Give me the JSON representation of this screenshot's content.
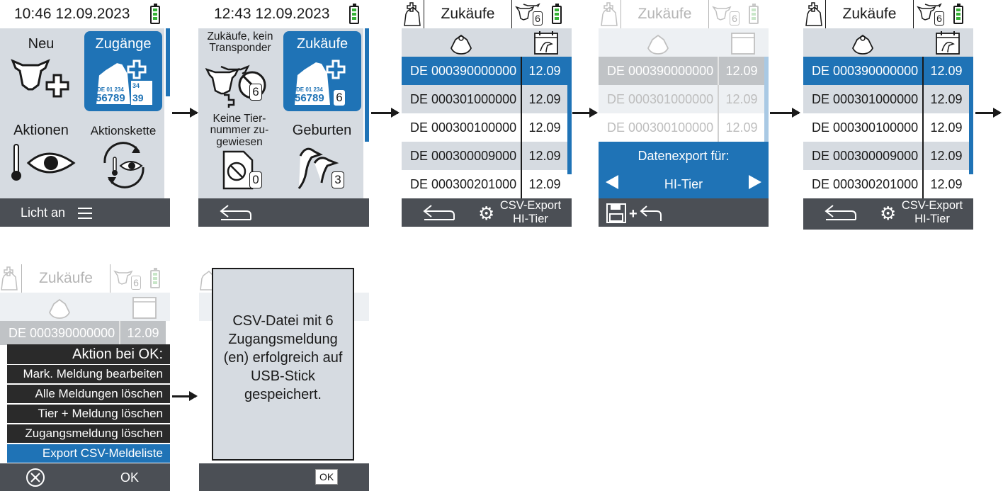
{
  "screen1": {
    "datetime": "10:46 12.09.2023",
    "tiles": [
      "Neu",
      "Zugänge",
      "Aktionen",
      "Aktionskette"
    ],
    "tag_text_line1": "DE 01 234",
    "tag_text_line2": "56789",
    "tag_side": "34",
    "tag_side2": "39",
    "footer_label": "Licht an"
  },
  "screen2": {
    "datetime": "12:43 12.09.2023",
    "tile1": "Zukäufe, kein Transponder",
    "tile2": "Zukäufe",
    "tile3": "Keine Tier-nummer zu-gewiesen",
    "tile4": "Geburten",
    "badge1": "6",
    "badge2": "6",
    "badge3": "0",
    "badge4": "3"
  },
  "list_screen": {
    "title": "Zukäufe",
    "badge": "6",
    "rows": [
      {
        "id": "DE 000390000000",
        "date": "12.09"
      },
      {
        "id": "DE 000301000000",
        "date": "12.09"
      },
      {
        "id": "DE 000300100000",
        "date": "12.09"
      },
      {
        "id": "DE 000300009000",
        "date": "12.09"
      },
      {
        "id": "DE 000300201000",
        "date": "12.09"
      }
    ],
    "footer_action": "CSV-Export",
    "footer_action2": "HI-Tier"
  },
  "export_dialog": {
    "title": "Datenexport für:",
    "value": "HI-Tier"
  },
  "menu_screen": {
    "header": "Aktion bei OK:",
    "items": [
      "Mark. Meldung bearbeiten",
      "Alle Meldungen löschen",
      "Tier + Meldung löschen",
      "Zugangsmeldung löschen",
      "Export CSV-Meldeliste"
    ],
    "ok": "OK"
  },
  "message_screen": {
    "message": "CSV-Datei mit 6 Zugangsmeldung (en) erfolgreich auf USB-Stick gespeichert.",
    "ok": "OK"
  },
  "colors": {
    "accent": "#1f73b6",
    "tile_bg": "#d6dbe1",
    "footer": "#4b4f55",
    "battery": "#35b035"
  }
}
